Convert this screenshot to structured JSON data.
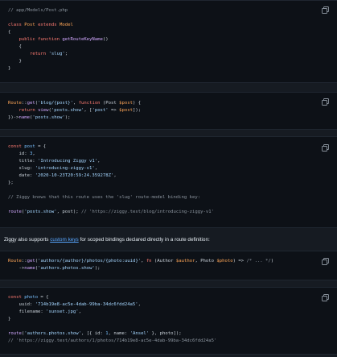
{
  "blocks": [
    {
      "lines": [
        [
          {
            "t": "// app/Models/Post.php",
            "c": "c"
          }
        ],
        [
          {
            "t": ""
          }
        ],
        [
          {
            "t": "class ",
            "c": "k"
          },
          {
            "t": "Post ",
            "c": "t"
          },
          {
            "t": "extends ",
            "c": "k"
          },
          {
            "t": "Model",
            "c": "t"
          }
        ],
        [
          {
            "t": "{"
          }
        ],
        [
          {
            "t": "    "
          },
          {
            "t": "public function ",
            "c": "k"
          },
          {
            "t": "getRouteKeyName",
            "c": "f"
          },
          {
            "t": "()"
          }
        ],
        [
          {
            "t": "    {"
          }
        ],
        [
          {
            "t": "        "
          },
          {
            "t": "return ",
            "c": "k"
          },
          {
            "t": "'slug'",
            "c": "s"
          },
          {
            "t": ";"
          }
        ],
        [
          {
            "t": "    }"
          }
        ],
        [
          {
            "t": "}"
          }
        ]
      ]
    },
    {
      "lines": [
        [
          {
            "t": "Route",
            "c": "t"
          },
          {
            "t": "::"
          },
          {
            "t": "get",
            "c": "f"
          },
          {
            "t": "("
          },
          {
            "t": "'blog/{post}'",
            "c": "s"
          },
          {
            "t": ", "
          },
          {
            "t": "function ",
            "c": "k"
          },
          {
            "t": "(Post "
          },
          {
            "t": "$post",
            "c": "v"
          },
          {
            "t": ") {"
          }
        ],
        [
          {
            "t": "    "
          },
          {
            "t": "return ",
            "c": "k"
          },
          {
            "t": "view",
            "c": "f"
          },
          {
            "t": "("
          },
          {
            "t": "'posts.show'",
            "c": "s"
          },
          {
            "t": ", ["
          },
          {
            "t": "'post'",
            "c": "s"
          },
          {
            "t": " => "
          },
          {
            "t": "$post",
            "c": "v"
          },
          {
            "t": "]);"
          }
        ],
        [
          {
            "t": "})->"
          },
          {
            "t": "name",
            "c": "f"
          },
          {
            "t": "("
          },
          {
            "t": "'posts.show'",
            "c": "s"
          },
          {
            "t": ");"
          }
        ]
      ]
    },
    {
      "lines": [
        [
          {
            "t": "const ",
            "c": "k"
          },
          {
            "t": "post",
            "c": "n"
          },
          {
            "t": " = {"
          }
        ],
        [
          {
            "t": "    id: "
          },
          {
            "t": "3",
            "c": "n"
          },
          {
            "t": ","
          }
        ],
        [
          {
            "t": "    title: "
          },
          {
            "t": "'Introducing Ziggy v1'",
            "c": "s"
          },
          {
            "t": ","
          }
        ],
        [
          {
            "t": "    slug: "
          },
          {
            "t": "'introducing-ziggy-v1'",
            "c": "s"
          },
          {
            "t": ","
          }
        ],
        [
          {
            "t": "    date: "
          },
          {
            "t": "'2020-10-23T20:59:24.359278Z'",
            "c": "s"
          },
          {
            "t": ","
          }
        ],
        [
          {
            "t": "};"
          }
        ],
        [
          {
            "t": ""
          }
        ],
        [
          {
            "t": "// Ziggy knows that this route uses the 'slug' route-model binding key:",
            "c": "c"
          }
        ],
        [
          {
            "t": ""
          }
        ],
        [
          {
            "t": "route",
            "c": "f"
          },
          {
            "t": "("
          },
          {
            "t": "'posts.show'",
            "c": "s"
          },
          {
            "t": ", post); "
          },
          {
            "t": "// 'https://ziggy.test/blog/introducing-ziggy-v1'",
            "c": "c"
          }
        ]
      ]
    },
    {
      "lines": [
        [
          {
            "t": "Route",
            "c": "t"
          },
          {
            "t": "::"
          },
          {
            "t": "get",
            "c": "f"
          },
          {
            "t": "("
          },
          {
            "t": "'authors/{author}/photos/{photo:uuid}'",
            "c": "s"
          },
          {
            "t": ", "
          },
          {
            "t": "fn ",
            "c": "k"
          },
          {
            "t": "(Author "
          },
          {
            "t": "$author",
            "c": "v"
          },
          {
            "t": ", Photo "
          },
          {
            "t": "$photo",
            "c": "v"
          },
          {
            "t": ") => "
          },
          {
            "t": "/* ... */",
            "c": "c"
          },
          {
            "t": ")"
          }
        ],
        [
          {
            "t": "    ->"
          },
          {
            "t": "name",
            "c": "f"
          },
          {
            "t": "("
          },
          {
            "t": "'authors.photos.show'",
            "c": "s"
          },
          {
            "t": ");"
          }
        ]
      ]
    },
    {
      "lines": [
        [
          {
            "t": "const ",
            "c": "k"
          },
          {
            "t": "photo",
            "c": "n"
          },
          {
            "t": " = {"
          }
        ],
        [
          {
            "t": "    uuid: "
          },
          {
            "t": "'714b19e8-ac5e-4dab-99ba-34dc6fdd24a5'",
            "c": "s"
          },
          {
            "t": ","
          }
        ],
        [
          {
            "t": "    filename: "
          },
          {
            "t": "'sunset.jpg'",
            "c": "s"
          },
          {
            "t": ","
          }
        ],
        [
          {
            "t": "}"
          }
        ],
        [
          {
            "t": ""
          }
        ],
        [
          {
            "t": "route",
            "c": "f"
          },
          {
            "t": "("
          },
          {
            "t": "'authors.photos.show'",
            "c": "s"
          },
          {
            "t": ", [{ id: "
          },
          {
            "t": "1",
            "c": "n"
          },
          {
            "t": ", name: "
          },
          {
            "t": "'Ansel'",
            "c": "s"
          },
          {
            "t": " }, photo]);"
          }
        ],
        [
          {
            "t": "// 'https://ziggy.test/authors/1/photos/714b19e8-ac5e-4dab-99ba-34dc6fdd24a5'",
            "c": "c"
          }
        ]
      ]
    }
  ],
  "prose": {
    "before": "Ziggy also supports ",
    "link": "custom keys",
    "after": " for scoped bindings declared directly in a route definition:"
  },
  "icons": {
    "copy": "copy-icon"
  }
}
